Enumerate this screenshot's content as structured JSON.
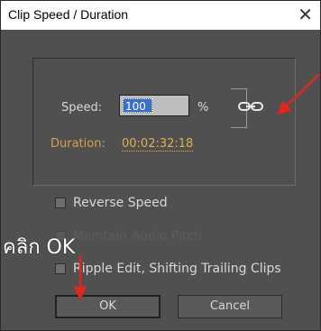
{
  "dialog": {
    "title": "Clip Speed / Duration",
    "close_glyph": "✕"
  },
  "speed": {
    "label": "Speed:",
    "value": "100",
    "unit": "%",
    "link_icon": "chain-link-icon"
  },
  "duration": {
    "label": "Duration:",
    "value": "00:02:32:18"
  },
  "options": [
    {
      "label": "Reverse Speed",
      "checked": false,
      "enabled": true
    },
    {
      "label": "Maintain Audio Pitch",
      "checked": false,
      "enabled": false
    },
    {
      "label": "Ripple Edit, Shifting Trailing Clips",
      "checked": false,
      "enabled": true
    }
  ],
  "buttons": {
    "ok": "OK",
    "cancel": "Cancel"
  },
  "annotation": {
    "text": "คลิก OK",
    "arrow_color": "#e3261c"
  },
  "colors": {
    "panel": "#505050",
    "duration_text": "#e0b04a",
    "selection": "#3a6fd1"
  }
}
